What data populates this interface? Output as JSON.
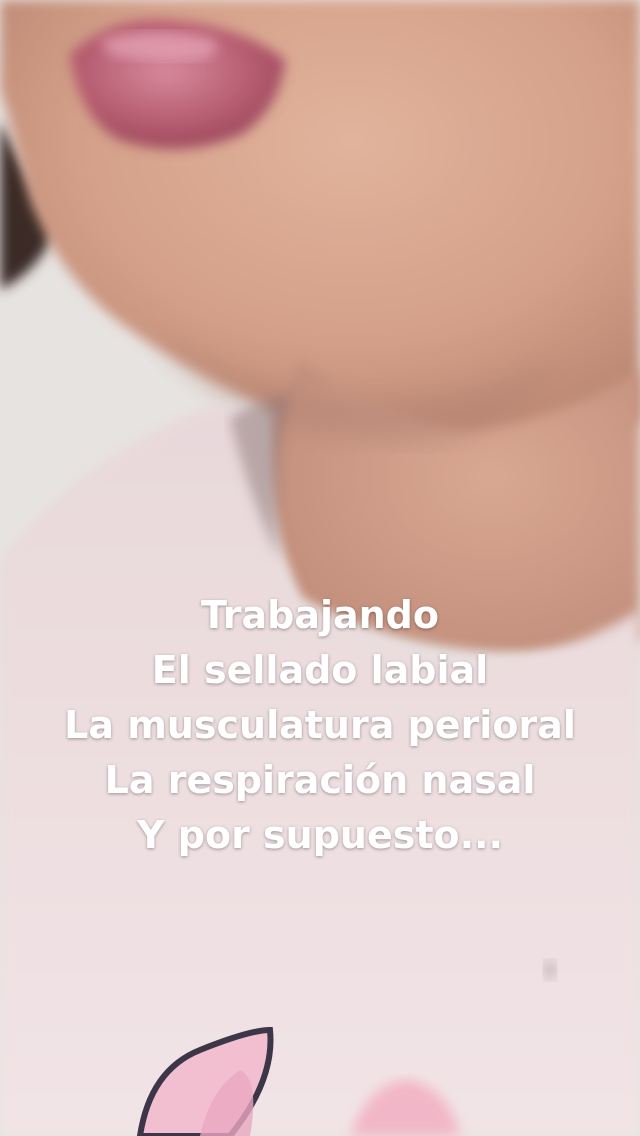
{
  "overlay": {
    "lines": [
      "Trabajando",
      "El sellado labial",
      "La musculatura perioral",
      "La respiración nasal",
      "Y por supuesto..."
    ],
    "text_color": "#ffffff"
  },
  "scene": {
    "subject": "child-lower-face-and-neck",
    "colors": {
      "skin": "#d8a48e",
      "lips": "#b85a70",
      "shirt": "#efdfe2",
      "wall": "#e7e3e1",
      "hair": "#3a2a27",
      "print_outline": "#3d3548",
      "print_fill": "#f2bfd0"
    }
  }
}
